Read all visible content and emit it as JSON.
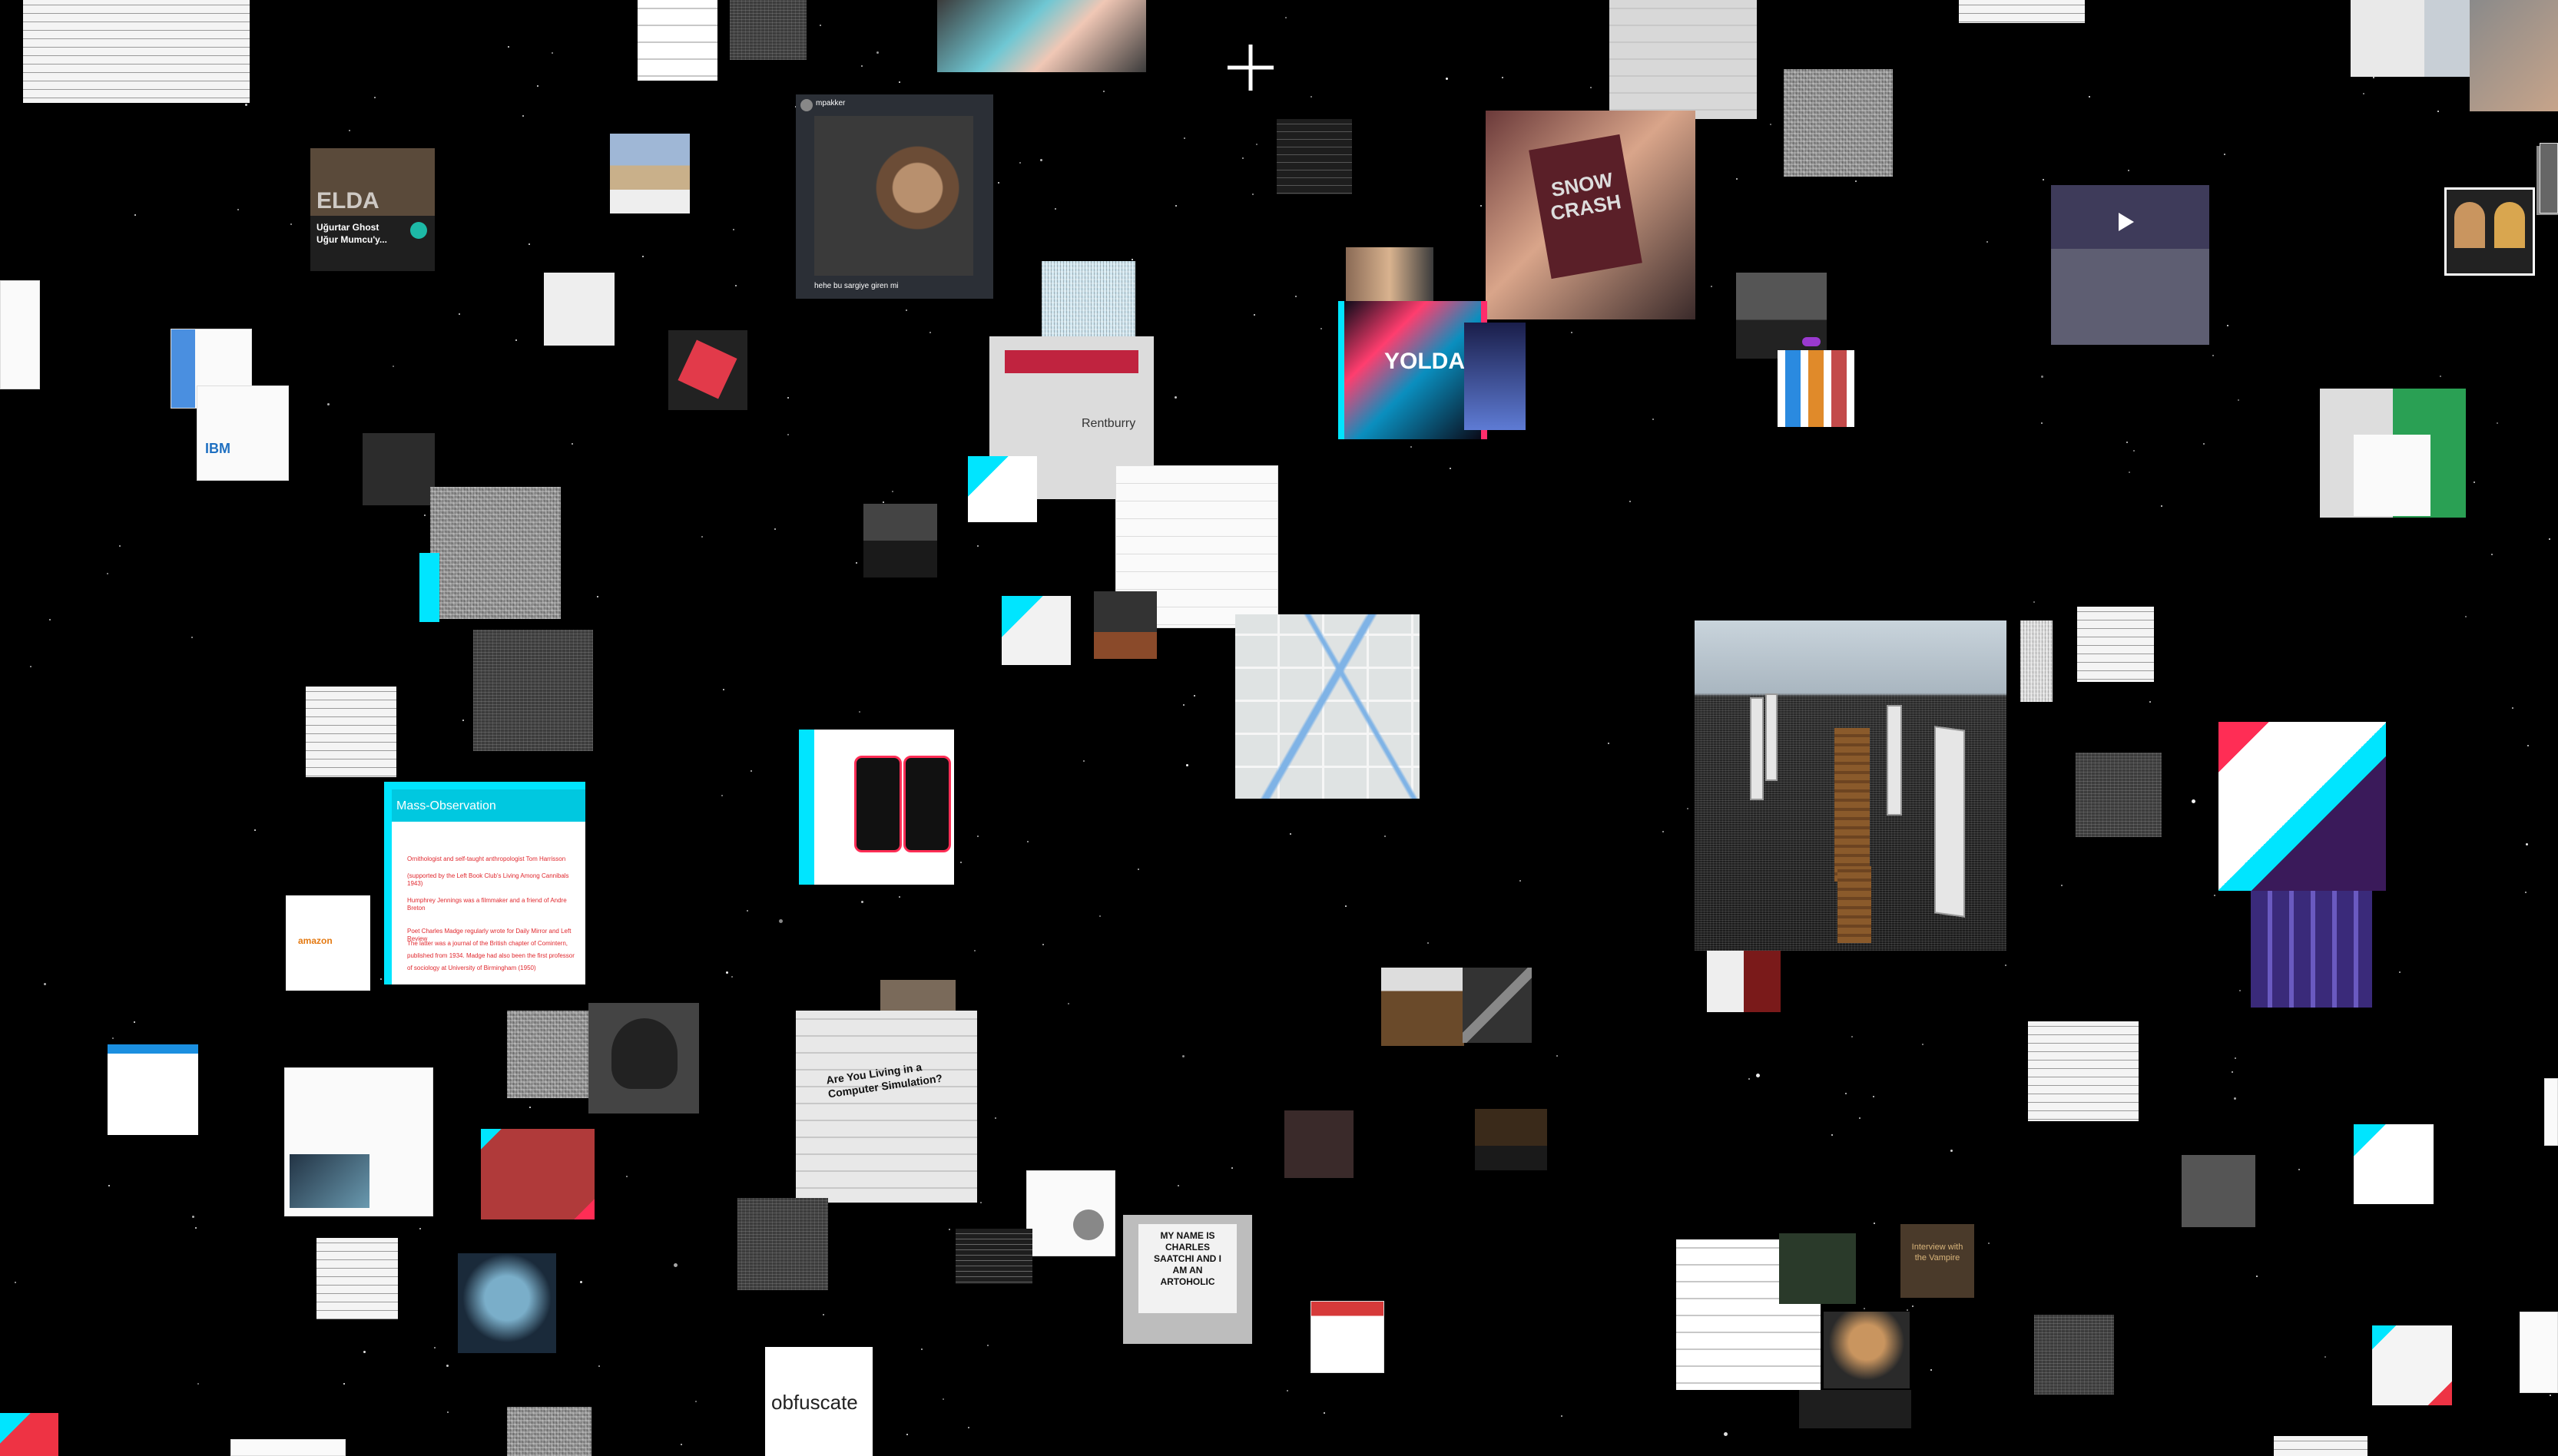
{
  "scene": {
    "background_color": "#000000",
    "cursor_icon": "crosshair-icon"
  },
  "tiles": {
    "elda_card": {
      "title": "ELDA",
      "subtitle": "Uğurtar Ghost",
      "line2": "Uğur Mumcu'y..."
    },
    "webcam_post": {
      "username": "mpakker",
      "caption": "hehe bu sargiye giren mi"
    },
    "yolda_poster": {
      "text": "YOLDA"
    },
    "snow_crash": {
      "line1": "SNOW",
      "line2": "CRASH"
    },
    "mass_observation": {
      "title": "Mass-Observation",
      "p1": "Ornithologist and self-taught anthropologist Tom Harrisson",
      "p1b": "(supported by the Left Book Club's Living Among Cannibals 1943)",
      "p2": "Humphrey Jennings was a filmmaker and a friend of Andre Breton",
      "p3": "Poet Charles Madge regularly wrote for Daily Mirror and Left Review",
      "p3b": "The latter was a journal of the British chapter of Comintern,",
      "p3c": "published from 1934. Madge had also been the first professor",
      "p3d": "of sociology at University of Birmingham (1950)"
    },
    "brands": {
      "label": "Rentburry"
    },
    "simulation": {
      "headline": "Are You Living in a Computer Simulation?"
    },
    "charles": {
      "text": "MY NAME IS CHARLES SAATCHI AND I AM AN ARTOHOLIC"
    },
    "obfuscate": {
      "text": "obfuscate"
    },
    "interview": {
      "text": "Interview with the Vampire"
    }
  }
}
